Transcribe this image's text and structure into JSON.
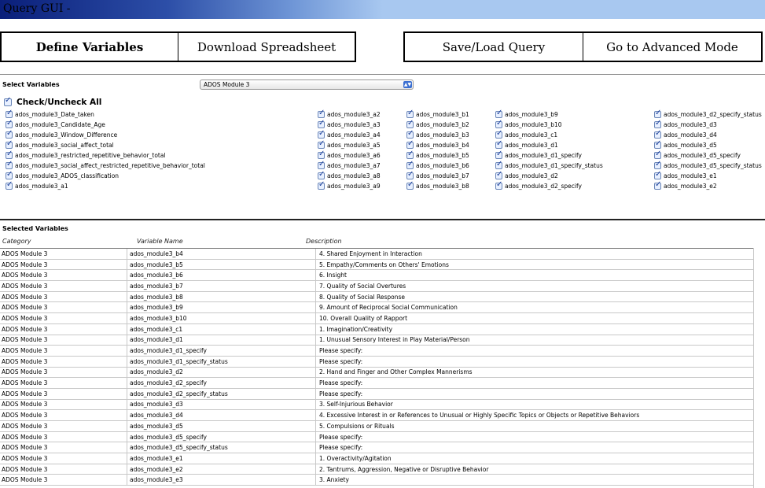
{
  "window": {
    "title": "Query GUI -"
  },
  "toolbar": {
    "left": [
      "Define Variables",
      "Download Spreadsheet"
    ],
    "right": [
      "Save/Load Query",
      "Go to Advanced Mode"
    ]
  },
  "select_section": {
    "label": "Select Variables",
    "dropdown_value": "ADOS Module 3",
    "check_all_label": "Check/Uncheck All",
    "columns": [
      [
        "ados_module3_Date_taken",
        "ados_module3_Candidate_Age",
        "ados_module3_Window_Difference",
        "ados_module3_social_affect_total",
        "ados_module3_restricted_repetitive_behavior_total",
        "ados_module3_social_affect_restricted_repetitive_behavior_total",
        "ados_module3_ADOS_classification",
        "ados_module3_a1"
      ],
      [
        "ados_module3_a2",
        "ados_module3_a3",
        "ados_module3_a4",
        "ados_module3_a5",
        "ados_module3_a6",
        "ados_module3_a7",
        "ados_module3_a8",
        "ados_module3_a9"
      ],
      [
        "ados_module3_b1",
        "ados_module3_b2",
        "ados_module3_b3",
        "ados_module3_b4",
        "ados_module3_b5",
        "ados_module3_b6",
        "ados_module3_b7",
        "ados_module3_b8"
      ],
      [
        "ados_module3_b9",
        "ados_module3_b10",
        "ados_module3_c1",
        "ados_module3_d1",
        "ados_module3_d1_specify",
        "ados_module3_d1_specify_status",
        "ados_module3_d2",
        "ados_module3_d2_specify"
      ],
      [
        "ados_module3_d2_specify_status",
        "ados_module3_d3",
        "ados_module3_d4",
        "ados_module3_d5",
        "ados_module3_d5_specify",
        "ados_module3_d5_specify_status",
        "ados_module3_e1",
        "ados_module3_e2"
      ]
    ]
  },
  "selected_section": {
    "label": "Selected Variables",
    "headers": [
      "Category",
      "Variable Name",
      "Description"
    ],
    "rows": [
      [
        "ADOS Module 3",
        "ados_module3_b4",
        "4. Shared Enjoyment in Interaction"
      ],
      [
        "ADOS Module 3",
        "ados_module3_b5",
        "5. Empathy/Comments on Others' Emotions"
      ],
      [
        "ADOS Module 3",
        "ados_module3_b6",
        "6. Insight"
      ],
      [
        "ADOS Module 3",
        "ados_module3_b7",
        "7. Quality of Social Overtures"
      ],
      [
        "ADOS Module 3",
        "ados_module3_b8",
        "8. Quality of Social Response"
      ],
      [
        "ADOS Module 3",
        "ados_module3_b9",
        "9. Amount of Reciprocal Social Communication"
      ],
      [
        "ADOS Module 3",
        "ados_module3_b10",
        "10. Overall Quality of Rapport"
      ],
      [
        "ADOS Module 3",
        "ados_module3_c1",
        "1. Imagination/Creativity"
      ],
      [
        "ADOS Module 3",
        "ados_module3_d1",
        "1. Unusual Sensory Interest in Play Material/Person"
      ],
      [
        "ADOS Module 3",
        "ados_module3_d1_specify",
        "Please specify:"
      ],
      [
        "ADOS Module 3",
        "ados_module3_d1_specify_status",
        "Please specify:"
      ],
      [
        "ADOS Module 3",
        "ados_module3_d2",
        "2. Hand and Finger and Other Complex Mannerisms"
      ],
      [
        "ADOS Module 3",
        "ados_module3_d2_specify",
        "Please specify:"
      ],
      [
        "ADOS Module 3",
        "ados_module3_d2_specify_status",
        "Please specify:"
      ],
      [
        "ADOS Module 3",
        "ados_module3_d3",
        "3. Self-Injurious Behavior"
      ],
      [
        "ADOS Module 3",
        "ados_module3_d4",
        "4. Excessive Interest in or References to Unusual or Highly Specific Topics or Objects or Repetitive Behaviors"
      ],
      [
        "ADOS Module 3",
        "ados_module3_d5",
        "5. Compulsions or Rituals"
      ],
      [
        "ADOS Module 3",
        "ados_module3_d5_specify",
        "Please specify:"
      ],
      [
        "ADOS Module 3",
        "ados_module3_d5_specify_status",
        "Please specify:"
      ],
      [
        "ADOS Module 3",
        "ados_module3_e1",
        "1. Overactivity/Agitation"
      ],
      [
        "ADOS Module 3",
        "ados_module3_e2",
        "2. Tantrums, Aggression, Negative or Disruptive Behavior"
      ],
      [
        "ADOS Module 3",
        "ados_module3_e3",
        "3. Anxiety"
      ]
    ]
  },
  "colors": {
    "titlebar_dark": "#0a1f7a",
    "titlebar_light": "#a8c8f0",
    "checkbox_accent": "#1a3e9a"
  }
}
